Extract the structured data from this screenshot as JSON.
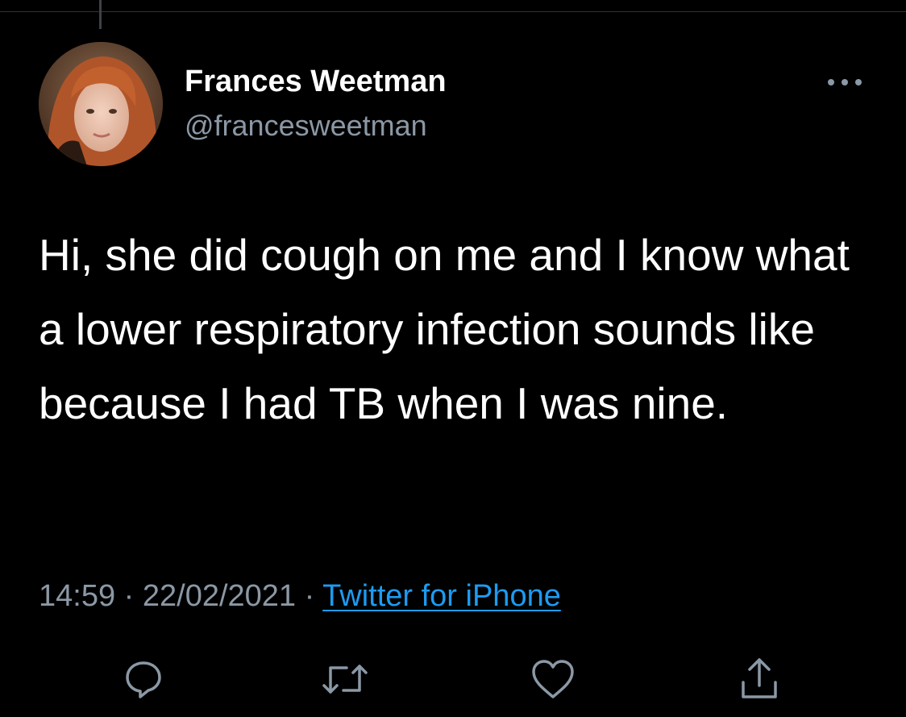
{
  "tweet": {
    "display_name": "Frances Weetman",
    "handle": "@francesweetman",
    "text": "Hi, she did cough on me and I know what a lower respiratory infection sounds like because I had TB when I was nine.",
    "time": "14:59",
    "separator": "·",
    "date": "22/02/2021",
    "source": "Twitter for iPhone"
  },
  "actions": {
    "reply_icon": "reply-icon",
    "retweet_icon": "retweet-icon",
    "like_icon": "heart-icon",
    "share_icon": "share-icon",
    "more_icon": "more-horizontal-icon"
  },
  "colors": {
    "background": "#000000",
    "primary_text": "#ffffff",
    "secondary_text": "#8b98a5",
    "link": "#1d9bf0",
    "icon": "#8b98a5"
  }
}
